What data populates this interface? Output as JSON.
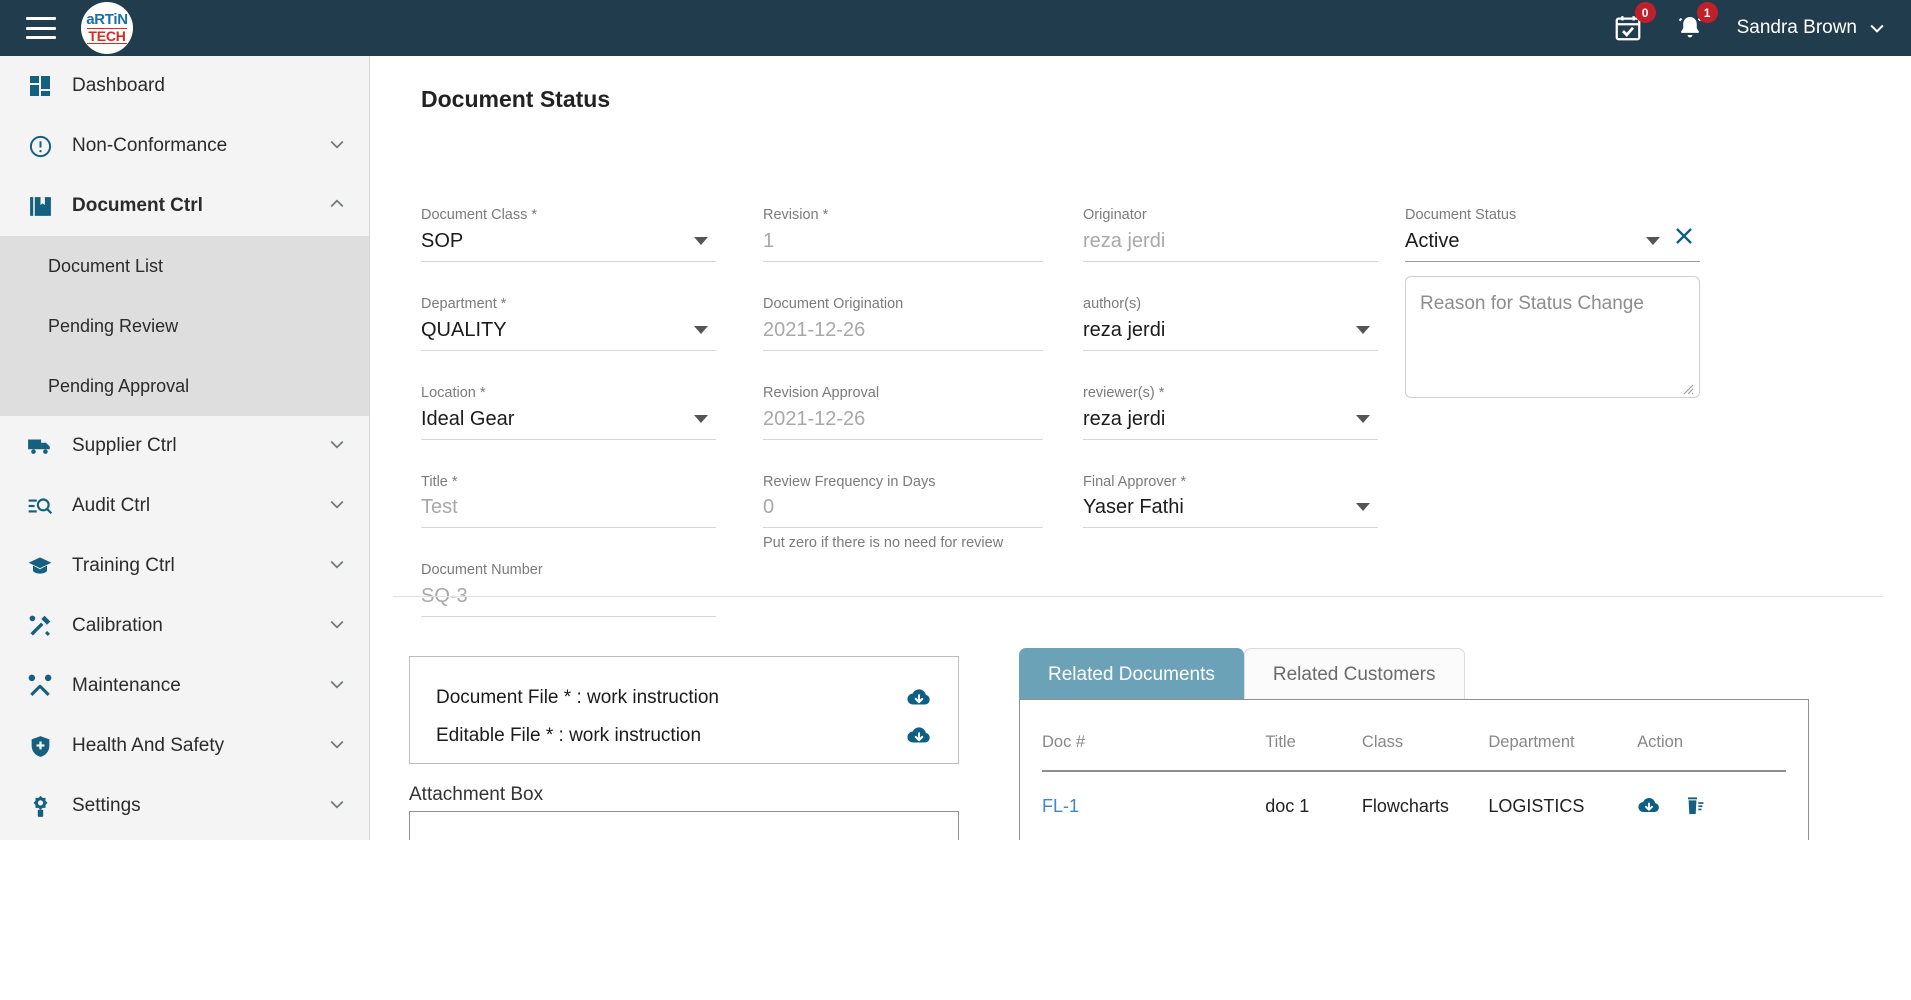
{
  "header": {
    "menu_icon": "hamburger-icon",
    "logo_top": "aRTiN",
    "logo_bottom": "TECH",
    "calendar_badge": "0",
    "bell_badge": "1",
    "user_name": "Sandra Brown"
  },
  "sidebar": {
    "items": [
      {
        "label": "Dashboard",
        "icon": "dashboard-icon",
        "expandable": false,
        "active": false
      },
      {
        "label": "Non-Conformance",
        "icon": "alert-circle-icon",
        "expandable": true,
        "active": false
      },
      {
        "label": "Document Ctrl",
        "icon": "book-icon",
        "expandable": true,
        "active": true
      },
      {
        "label": "Supplier Ctrl",
        "icon": "truck-icon",
        "expandable": true,
        "active": false
      },
      {
        "label": "Audit Ctrl",
        "icon": "audit-search-icon",
        "expandable": true,
        "active": false
      },
      {
        "label": "Training Ctrl",
        "icon": "graduation-cap-icon",
        "expandable": true,
        "active": false
      },
      {
        "label": "Calibration",
        "icon": "calibration-tools-icon",
        "expandable": true,
        "active": false
      },
      {
        "label": "Maintenance",
        "icon": "hammer-wrench-icon",
        "expandable": true,
        "active": false
      },
      {
        "label": "Health And Safety",
        "icon": "shield-plus-icon",
        "expandable": true,
        "active": false
      },
      {
        "label": "Settings",
        "icon": "gear-icon",
        "expandable": true,
        "active": false
      }
    ],
    "submenu": [
      {
        "label": "Document List"
      },
      {
        "label": "Pending Review"
      },
      {
        "label": "Pending Approval"
      }
    ]
  },
  "main": {
    "page_title": "Document Status",
    "fields": {
      "document_class": {
        "label": "Document Class *",
        "value": "SOP",
        "placeholder": false
      },
      "department": {
        "label": "Department *",
        "value": "QUALITY",
        "placeholder": false
      },
      "location": {
        "label": "Location *",
        "value": "Ideal Gear",
        "placeholder": false
      },
      "title": {
        "label": "Title *",
        "value": "Test",
        "placeholder": true
      },
      "document_number": {
        "label": "Document Number",
        "value": "SQ-3",
        "placeholder": true
      },
      "revision": {
        "label": "Revision *",
        "value": "1",
        "placeholder": true
      },
      "document_origination": {
        "label": "Document Origination",
        "value": "2021-12-26",
        "placeholder": true
      },
      "revision_approval": {
        "label": "Revision Approval",
        "value": "2021-12-26",
        "placeholder": true
      },
      "review_frequency": {
        "label": "Review Frequency in Days",
        "value": "0",
        "placeholder": true
      },
      "review_frequency_helper": "Put zero if there is no need for review",
      "originator": {
        "label": "Originator",
        "value": "reza jerdi",
        "placeholder": true
      },
      "authors": {
        "label": "author(s)",
        "value": "reza jerdi",
        "placeholder": false
      },
      "reviewers": {
        "label": "reviewer(s) *",
        "value": "reza jerdi",
        "placeholder": false
      },
      "final_approver": {
        "label": "Final Approver *",
        "value": "Yaser Fathi",
        "placeholder": false
      },
      "document_status": {
        "label": "Document Status",
        "value": "Active",
        "placeholder": false
      },
      "reason_for_status_change": {
        "placeholder": "Reason for Status Change",
        "value": ""
      }
    },
    "files": {
      "document_file_label": "Document File *  :  work instruction",
      "editable_file_label": "Editable File *  :  work instruction",
      "download_icon": "cloud-download-icon"
    },
    "attachment_box_label": "Attachment Box",
    "tabs": [
      {
        "label": "Related Documents",
        "active": true
      },
      {
        "label": "Related Customers",
        "active": false
      }
    ],
    "related_table": {
      "columns": [
        "Doc #",
        "Title",
        "Class",
        "Department",
        "Action"
      ],
      "rows": [
        {
          "doc_no": "FL-1",
          "title": "doc 1",
          "class": "Flowcharts",
          "department": "LOGISTICS",
          "actions": [
            "cloud-download-icon",
            "trash-icon"
          ]
        }
      ]
    }
  },
  "colors": {
    "header_bg": "#213d4d",
    "sidebar_bg": "#f4f4f4",
    "submenu_bg": "#dedede",
    "accent_icon": "#15607f",
    "badge_red": "#c0202a",
    "tab_active": "#6ba2b8",
    "link_blue": "#3f87c9"
  }
}
